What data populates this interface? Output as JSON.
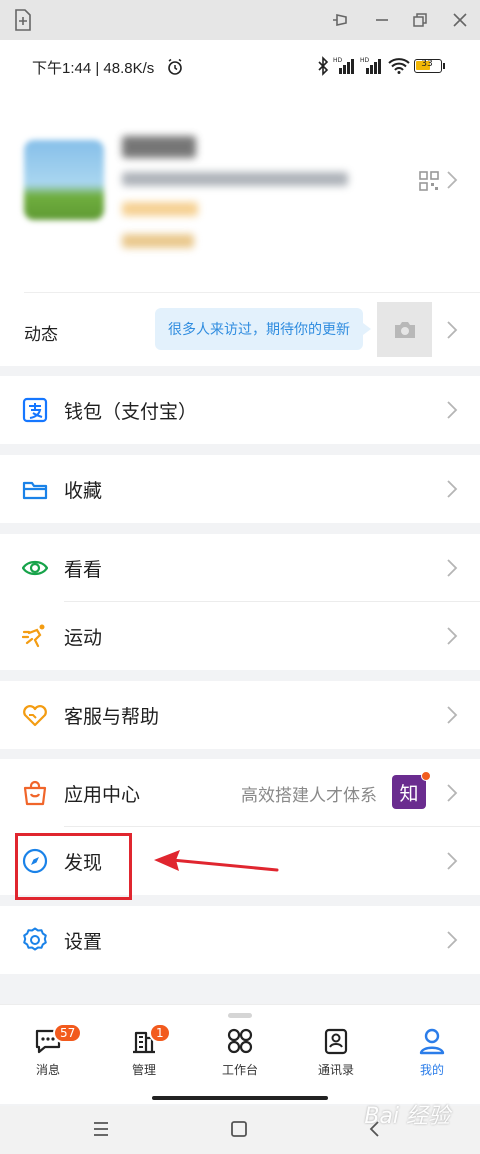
{
  "status_bar": {
    "time": "下午1:44 | 48.8K/s",
    "battery": "33"
  },
  "moments": {
    "label": "动态",
    "hint": "很多人来访过，期待你的更新"
  },
  "menu": {
    "wallet": "钱包（支付宝）",
    "favorites": "收藏",
    "watch": "看看",
    "sport": "运动",
    "service": "客服与帮助",
    "apps": "应用中心",
    "apps_promo": "高效搭建人才体系",
    "apps_promo_badge": "知",
    "discover": "发现",
    "settings": "设置"
  },
  "tabs": {
    "messages": {
      "label": "消息",
      "badge": "57"
    },
    "manage": {
      "label": "管理",
      "badge": "1"
    },
    "workbench": {
      "label": "工作台"
    },
    "contacts": {
      "label": "通讯录"
    },
    "me": {
      "label": "我的"
    }
  },
  "colors": {
    "accent": "#2b7de9",
    "highlight": "#e0262f",
    "badge": "#f25a1d"
  },
  "watermark": "Bai 经验"
}
